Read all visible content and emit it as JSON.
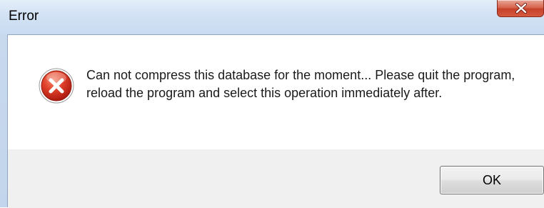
{
  "window": {
    "title": "Error",
    "close_icon": "close-icon"
  },
  "dialog": {
    "icon": "error-icon",
    "message": "Can not compress this database for the moment... Please quit the program, reload the program and select this operation immediately after."
  },
  "footer": {
    "ok_label": "OK"
  },
  "colors": {
    "error_red": "#d42b1e",
    "close_button_red": "#c7412a",
    "footer_background": "#f0f0f0",
    "titlebar_blue": "#c9dbf1"
  }
}
